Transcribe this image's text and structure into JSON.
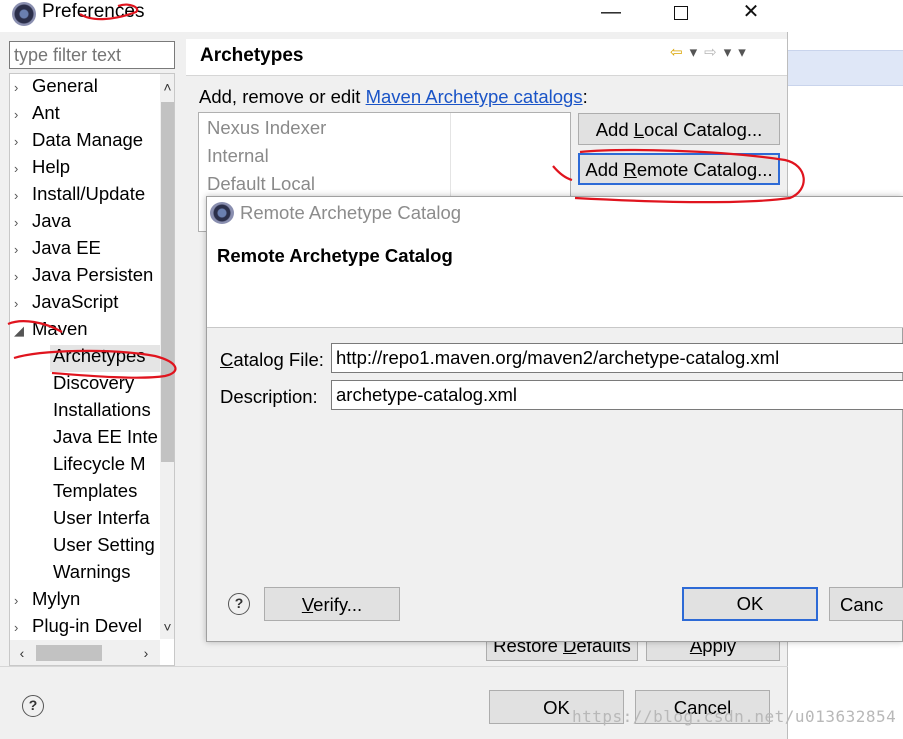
{
  "window": {
    "title": "Preferences"
  },
  "filter": {
    "placeholder": "type filter text"
  },
  "tree": {
    "items": [
      {
        "label": "General",
        "expanded": false
      },
      {
        "label": "Ant",
        "expanded": false
      },
      {
        "label": "Data Manage",
        "expanded": false
      },
      {
        "label": "Help",
        "expanded": false
      },
      {
        "label": "Install/Update",
        "expanded": false
      },
      {
        "label": "Java",
        "expanded": false
      },
      {
        "label": "Java EE",
        "expanded": false
      },
      {
        "label": "Java Persisten",
        "expanded": false
      },
      {
        "label": "JavaScript",
        "expanded": false
      },
      {
        "label": "Maven",
        "expanded": true
      },
      {
        "label": "Archetypes",
        "child": true,
        "selected": true
      },
      {
        "label": "Discovery",
        "child": true
      },
      {
        "label": "Installations",
        "child": true
      },
      {
        "label": "Java EE Inte",
        "child": true
      },
      {
        "label": "Lifecycle M",
        "child": true
      },
      {
        "label": "Templates",
        "child": true
      },
      {
        "label": "User Interfa",
        "child": true
      },
      {
        "label": "User Setting",
        "child": true
      },
      {
        "label": "Warnings",
        "child": true
      },
      {
        "label": "Mylyn",
        "expanded": false
      },
      {
        "label": "Plug-in Devel",
        "expanded": false
      }
    ]
  },
  "panel": {
    "title": "Archetypes",
    "description_prefix": "Add, remove or edit ",
    "description_link": "Maven Archetype catalogs",
    "description_suffix": ":",
    "catalogs": [
      "Nexus Indexer",
      "Internal",
      "Default Local"
    ],
    "add_local_pre": "Add ",
    "add_local_u": "L",
    "add_local_post": "ocal Catalog...",
    "add_remote_pre": "Add ",
    "add_remote_u": "R",
    "add_remote_post": "emote Catalog...",
    "restore_pre": "Restore ",
    "restore_u": "D",
    "restore_post": "efaults",
    "apply_pre": "",
    "apply_u": "A",
    "apply_post": "pply"
  },
  "footer": {
    "ok_label": "OK",
    "cancel_label": "Cancel"
  },
  "dialog": {
    "title": "Remote Archetype Catalog",
    "heading": "Remote Archetype Catalog",
    "catalog_file_u": "C",
    "catalog_file_rest": "atalog File:",
    "catalog_file_value": "http://repo1.maven.org/maven2/archetype-catalog.xml",
    "description_label": "Description:",
    "description_value": "archetype-catalog.xml",
    "verify_u": "V",
    "verify_rest": "erify...",
    "ok_label": "OK",
    "cancel_label": "Canc"
  },
  "watermark": "https://blog.csdn.net/u013632854",
  "colors": {
    "accent_border": "#2d6ad6",
    "link": "#1a54c7",
    "annotation": "#e0141e"
  }
}
